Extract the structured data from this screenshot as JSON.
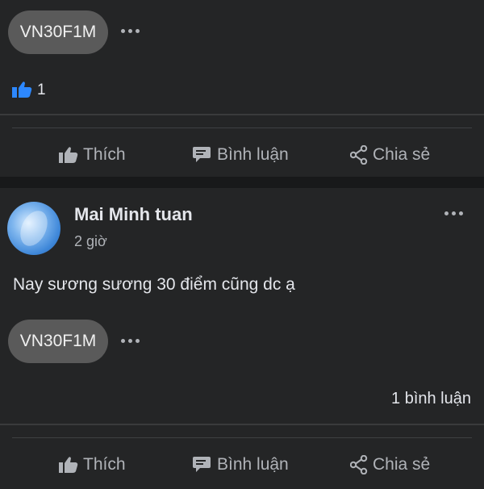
{
  "post1": {
    "tag": "VN30F1M",
    "like_count": "1",
    "actions": {
      "like": "Thích",
      "comment": "Bình luận",
      "share": "Chia sẻ"
    }
  },
  "post2": {
    "author": "Mai Minh tuan",
    "time": "2 giờ",
    "body": "Nay sương sương 30 điểm cũng dc ạ",
    "tag": "VN30F1M",
    "comment_count": "1 bình luận",
    "actions": {
      "like": "Thích",
      "comment": "Bình luận",
      "share": "Chia sẻ"
    }
  },
  "colors": {
    "background": "#242526",
    "separator": "#18191a",
    "pill": "#5a5a5a",
    "like_blue": "#2d88ff",
    "muted": "#b0b3b8"
  }
}
